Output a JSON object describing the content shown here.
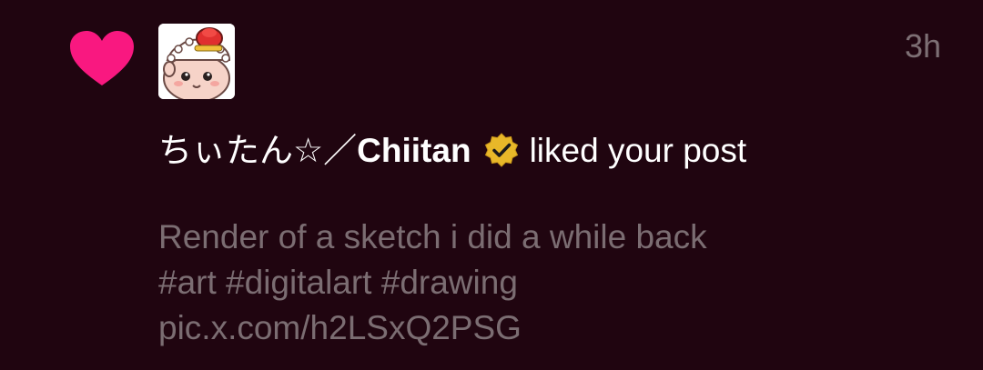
{
  "notification": {
    "timestamp": "3h",
    "user_display_name": "ちぃたん☆／Chiitan",
    "user_name_prefix": "ちぃたん☆／",
    "user_name_bold": "Chiitan",
    "action_text": "liked your post",
    "post_lines": [
      "Render of a sketch i did a while back",
      "#art #digitalart #drawing",
      "pic.x.com/h2LSxQ2PSG"
    ]
  },
  "colors": {
    "background": "#200510",
    "heart": "#f91880",
    "verified_badge": "#e8b829",
    "muted_text": "#7b6d72"
  },
  "icons": {
    "like": "heart-icon",
    "verified": "verified-badge-icon"
  }
}
